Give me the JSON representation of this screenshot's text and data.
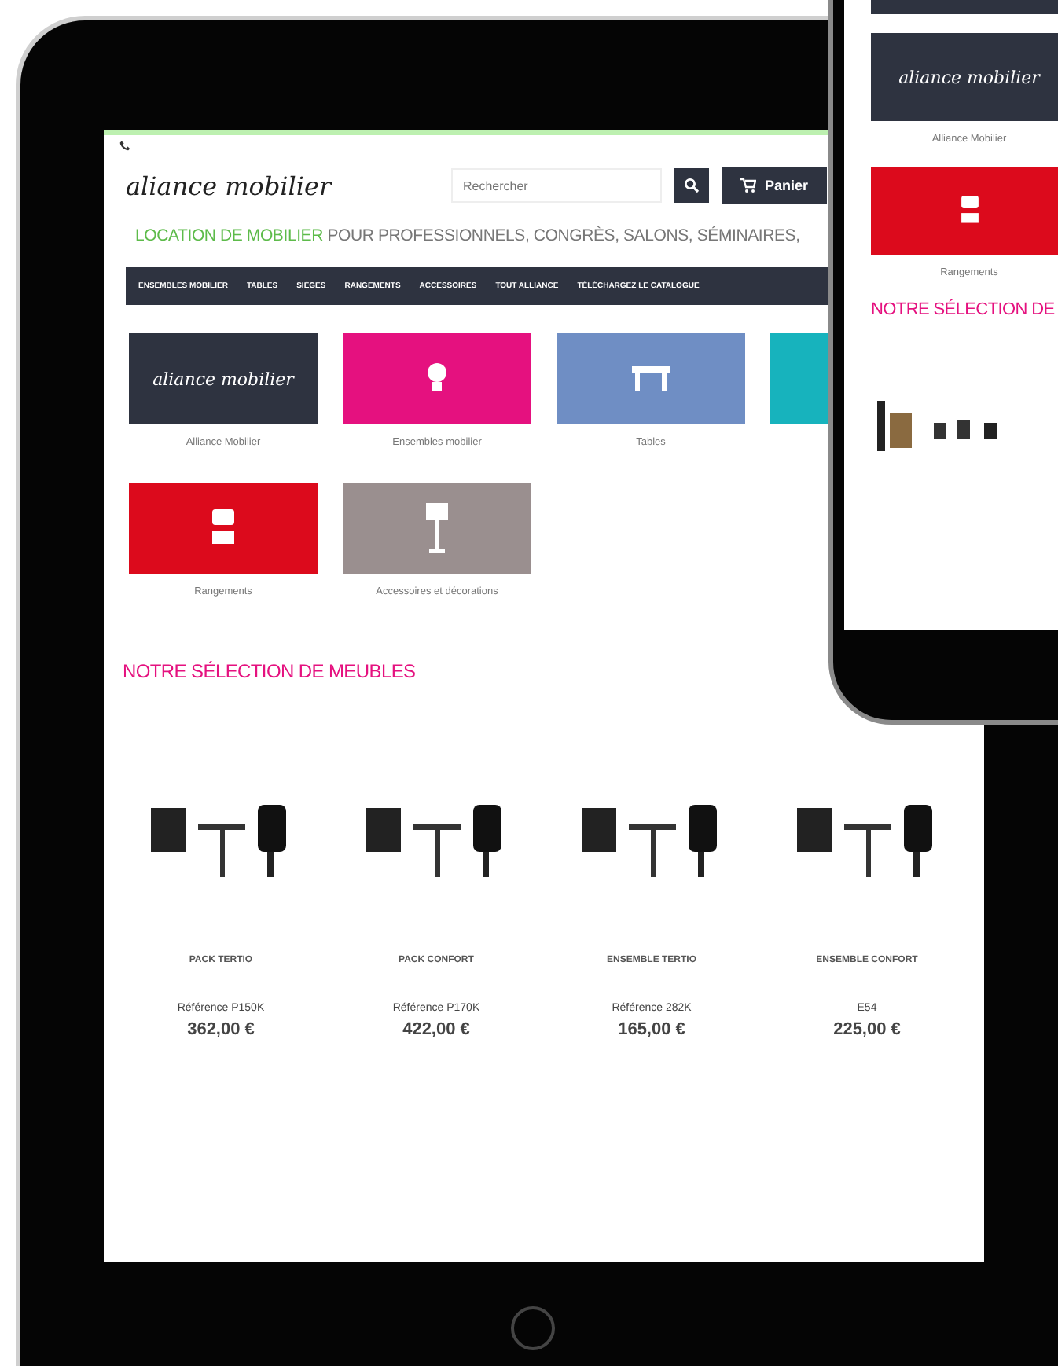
{
  "tablet": {
    "header": {
      "logo": "aliance mobilier",
      "search": {
        "placeholder": "Rechercher"
      },
      "cart": {
        "label": "Panier"
      }
    },
    "tagline": {
      "highlight": "LOCATION DE MOBILIER",
      "rest": " POUR PROFESSIONNELS, CONGRÈS, SALONS, SÉMINAIRES,"
    },
    "nav": [
      {
        "label": "ENSEMBLES MOBILIER"
      },
      {
        "label": "TABLES"
      },
      {
        "label": "SIÈGES"
      },
      {
        "label": "RANGEMENTS"
      },
      {
        "label": "ACCESSOIRES"
      },
      {
        "label": "TOUT ALLIANCE"
      },
      {
        "label": "TÉLÉCHARGEZ LE CATALOGUE"
      }
    ],
    "categories": [
      {
        "title": "Alliance Mobilier",
        "kind": "logo",
        "logo": "aliance mobilier",
        "color": "#2e3340"
      },
      {
        "title": "Ensembles mobilier",
        "kind": "bulb",
        "color": "#e5117f"
      },
      {
        "title": "Tables",
        "kind": "table",
        "color": "#6f8ec4"
      },
      {
        "kind": "plain",
        "color": "#17b3bd"
      },
      {
        "title": "Rangements",
        "kind": "cabinet",
        "color": "#dc0a1c"
      },
      {
        "title": "Accessoires et décorations",
        "kind": "lamp",
        "color": "#9a8f8f"
      }
    ],
    "section_title": "NOTRE SÉLECTION DE MEUBLES",
    "products": [
      {
        "name": "PACK TERTIO",
        "reference": "Référence P150K",
        "price": "362,00 €"
      },
      {
        "name": "PACK CONFORT",
        "reference": "Référence P170K",
        "price": "422,00 €"
      },
      {
        "name": "ENSEMBLE TERTIO",
        "reference": "Référence 282K",
        "price": "165,00 €"
      },
      {
        "name": "ENSEMBLE CONFORT",
        "reference": "E54",
        "price": "225,00 €"
      }
    ]
  },
  "phone": {
    "categories": [
      {
        "title": "Alliance Mobilier",
        "kind": "logo",
        "logo": "aliance mobilier",
        "color": "#2e3340"
      },
      {
        "title": "Rangements",
        "kind": "cabinet",
        "color": "#dc0a1c"
      }
    ],
    "section_title": "NOTRE SÉLECTION DE"
  }
}
